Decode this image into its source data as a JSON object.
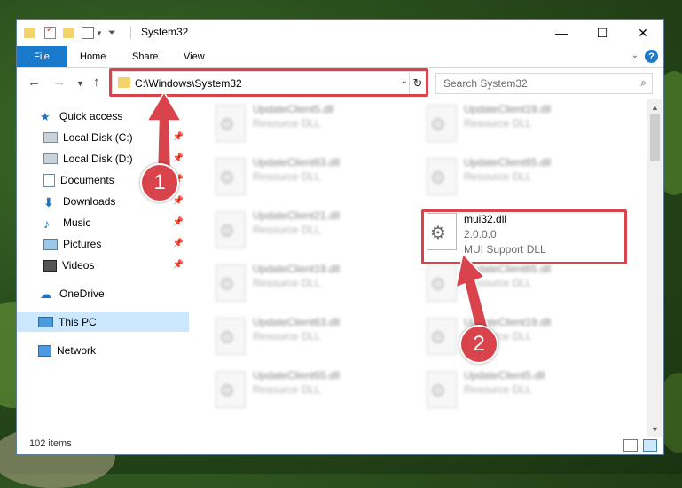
{
  "window": {
    "title": "System32"
  },
  "ribbon": {
    "tabs": [
      "File",
      "Home",
      "Share",
      "View"
    ],
    "file_color": "#1979ca"
  },
  "address": {
    "path": "C:\\Windows\\System32"
  },
  "search": {
    "placeholder": "Search System32"
  },
  "sidebar": {
    "quick_access": "Quick access",
    "items": [
      "Local Disk (C:)",
      "Local Disk (D:)",
      "Documents",
      "Downloads",
      "Music",
      "Pictures",
      "Videos"
    ],
    "onedrive": "OneDrive",
    "thispc": "This PC",
    "network": "Network"
  },
  "files": {
    "col1": [
      {
        "name": "UpdateClient5.dll",
        "desc": "Resource DLL"
      },
      {
        "name": "UpdateClient63.dll",
        "desc": "Resource DLL"
      },
      {
        "name": "UpdateClient21.dll",
        "desc": "Resource DLL"
      },
      {
        "name": "UpdateClient19.dll",
        "desc": "Resource DLL"
      },
      {
        "name": "UpdateClient63.dll",
        "desc": "Resource DLL"
      },
      {
        "name": "UpdateClient65.dll",
        "desc": "Resource DLL"
      }
    ],
    "col2": [
      {
        "name": "UpdateClient19.dll",
        "desc": "Resource DLL"
      },
      {
        "name": "UpdateClient65.dll",
        "desc": "Resource DLL"
      },
      {
        "name": "UpdateClient65.dll",
        "desc": "Resource DLL"
      },
      {
        "name": "UpdateClient19.dll",
        "desc": "Resource DLL"
      },
      {
        "name": "UpdateClient5.dll",
        "desc": "Resource DLL"
      }
    ],
    "highlighted": {
      "name": "mui32.dll",
      "version": "2.0.0.0",
      "desc": "MUI Support DLL"
    }
  },
  "status": {
    "count": "102 items"
  },
  "annotations": {
    "badge1": "1",
    "badge2": "2",
    "color": "#d9434b"
  }
}
